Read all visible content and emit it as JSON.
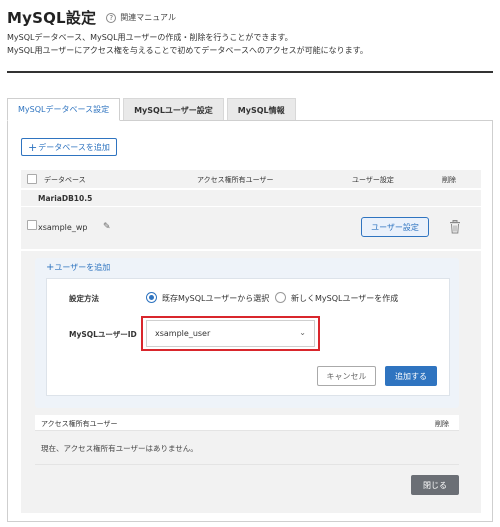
{
  "header": {
    "title": "MySQL設定",
    "manual_label": "関連マニュアル",
    "manual_icon": "question-circle-icon"
  },
  "description": {
    "line1": "MySQLデータベース、MySQL用ユーザーの作成・削除を行うことができます。",
    "line2": "MySQL用ユーザーにアクセス権を与えることで初めてデータベースへのアクセスが可能になります。"
  },
  "tabs": [
    {
      "label": "MySQLデータベース設定",
      "active": true
    },
    {
      "label": "MySQLユーザー設定",
      "active": false
    },
    {
      "label": "MySQL情報",
      "active": false
    }
  ],
  "toolbar": {
    "add_db_label": "データベースを追加",
    "add_icon": "plus-icon"
  },
  "table": {
    "columns": [
      "データベース",
      "アクセス権所有ユーザー",
      "ユーザー設定",
      "削除"
    ]
  },
  "db_group": "MariaDB10.5",
  "db_row": {
    "name": "xsample_wp",
    "edit_icon": "pencil-icon",
    "user_setting_label": "ユーザー設定",
    "delete_icon": "trash-icon"
  },
  "add_user": {
    "link_label": "ユーザーを追加",
    "method_label": "設定方法",
    "option_existing": "既存MySQLユーザーから選択",
    "option_new": "新しくMySQLユーザーを作成",
    "selected_option": "existing",
    "user_id_label": "MySQLユーザーID",
    "selected_user": "xsample_user",
    "cancel_label": "キャンセル",
    "submit_label": "追加する"
  },
  "access_table": {
    "columns": [
      "アクセス権所有ユーザー",
      "削除"
    ],
    "empty_message": "現在、アクセス権所有ユーザーはありません。"
  },
  "close_label": "閉じる",
  "colors": {
    "accent": "#2f74c0",
    "highlight": "#d9262c",
    "close_button": "#6b6f75"
  }
}
